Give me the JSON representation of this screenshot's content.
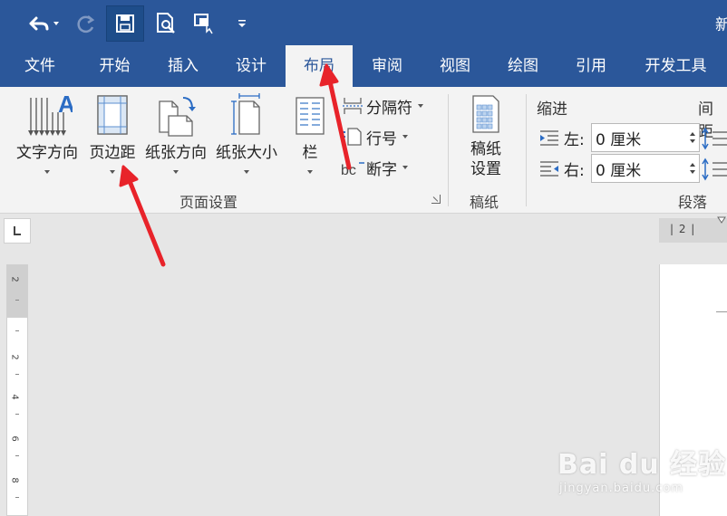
{
  "title_bar": {
    "doc_title": "新",
    "quick_access": [
      "undo-icon",
      "redo-icon",
      "save-icon",
      "print-preview-icon",
      "touch-mode-icon",
      "customize-icon"
    ]
  },
  "tabs": [
    {
      "label": "文件"
    },
    {
      "label": "开始"
    },
    {
      "label": "插入"
    },
    {
      "label": "设计"
    },
    {
      "label": "布局",
      "active": true
    },
    {
      "label": "审阅"
    },
    {
      "label": "视图"
    },
    {
      "label": "绘图"
    },
    {
      "label": "引用"
    },
    {
      "label": "开发工具"
    }
  ],
  "ribbon": {
    "page_setup": {
      "group_label": "页面设置",
      "text_direction": "文字方向",
      "margins": "页边距",
      "orientation": "纸张方向",
      "size": "纸张大小",
      "columns": "栏",
      "breaks": "分隔符",
      "line_numbers": "行号",
      "hyphenation": "断字"
    },
    "manuscript": {
      "group_label": "稿纸",
      "button_line1": "稿纸",
      "button_line2": "设置"
    },
    "paragraph": {
      "group_label": "段落",
      "indent_heading": "缩进",
      "spacing_heading": "间距",
      "left_label": "左:",
      "left_value": "0 厘米",
      "right_label": "右:",
      "right_value": "0 厘米"
    }
  },
  "ruler": {
    "h_text": "| 2 |",
    "v_numbers": [
      "2",
      "2",
      "4",
      "6",
      "8"
    ]
  },
  "watermark": {
    "main": "Bai du 经验",
    "sub": "jingyan.baidu.com"
  },
  "colors": {
    "brand_blue": "#2b579a",
    "ribbon_bg": "#f3f3f3",
    "annotation_red": "#e8232a"
  }
}
